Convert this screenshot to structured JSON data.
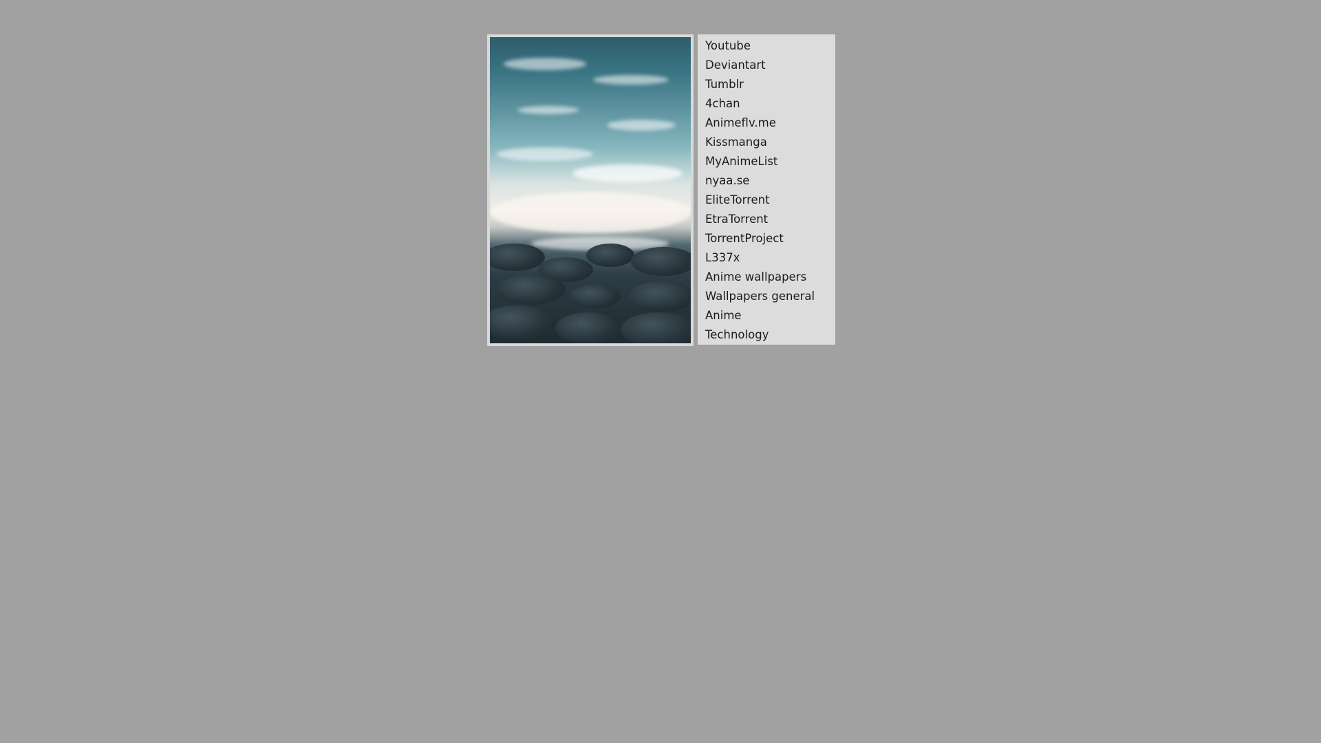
{
  "links": [
    {
      "label": "Youtube"
    },
    {
      "label": "Deviantart"
    },
    {
      "label": "Tumblr"
    },
    {
      "label": "4chan"
    },
    {
      "label": "Animeflv.me"
    },
    {
      "label": "Kissmanga"
    },
    {
      "label": "MyAnimeList"
    },
    {
      "label": "nyaa.se"
    },
    {
      "label": "EliteTorrent"
    },
    {
      "label": "EtraTorrent"
    },
    {
      "label": "TorrentProject"
    },
    {
      "label": "L337x"
    },
    {
      "label": "Anime wallpapers"
    },
    {
      "label": "Wallpapers general"
    },
    {
      "label": "Anime"
    },
    {
      "label": "Technology"
    }
  ],
  "colors": {
    "background": "#a0a1a0",
    "panel": "#dcdcdc",
    "text": "#1a1a1a"
  }
}
